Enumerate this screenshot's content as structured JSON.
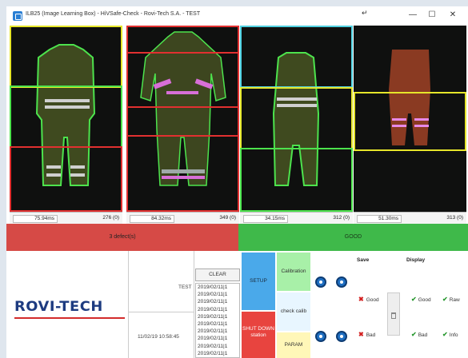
{
  "window": {
    "title": "ILB25 (Image Learning Box) - HiVSafe-Check - Rovi-Tech S.A. - TEST",
    "controls": {
      "minimize": "—",
      "maximize": "☐",
      "close": "✕"
    },
    "pin_icon": "↵"
  },
  "cameras": [
    {
      "time": "75.94ms",
      "count": "276 (0)"
    },
    {
      "time": "84.32ms",
      "count": "349 (0)"
    },
    {
      "time": "34.15ms",
      "count": "312 (0)"
    },
    {
      "time": "51.30ms",
      "count": "313 (0)"
    }
  ],
  "status": {
    "defects": "3 defect(s)",
    "good": "GOOD",
    "colors": {
      "defect": "#d64a46",
      "good": "#3fb94a"
    }
  },
  "brand": {
    "logo": "ROVI-TECH",
    "logo_color": "#1d3b80",
    "rule_color": "#d32b2b"
  },
  "info": {
    "test_label": "TEST",
    "datetime": "11/02/19 10:58:45"
  },
  "log": {
    "clear_label": "CLEAR",
    "lines": [
      "2019/02/11|1",
      "2019/02/11|1",
      "2019/02/11|1",
      "2019/02/11|1",
      "2019/02/11|1",
      "2019/02/11|1",
      "2019/02/11|1",
      "2019/02/11|1",
      "2019/02/11|1",
      "2019/02/11|1"
    ]
  },
  "actions": {
    "setup": "SETUP",
    "shutdown": "SHUT DOWN station",
    "calibration": "Calibration",
    "check_calib": "check calib",
    "param": "PARAM"
  },
  "save": {
    "title": "Save",
    "good": "Good",
    "bad": "Bad"
  },
  "display": {
    "title": "Display",
    "good": "Good",
    "raw": "Raw",
    "bad": "Bad",
    "info": "Info"
  }
}
